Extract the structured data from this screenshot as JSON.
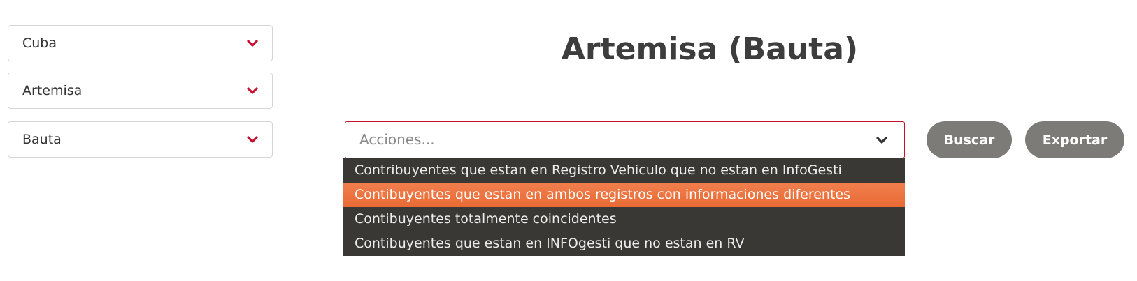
{
  "filters": {
    "country": {
      "selected": "Cuba"
    },
    "province": {
      "selected": "Artemisa"
    },
    "municipality": {
      "selected": "Bauta"
    }
  },
  "page_title": "Artemisa (Bauta)",
  "actions": {
    "placeholder": "Acciones...",
    "options": [
      "Contribuyentes que estan en Registro Vehiculo que no estan en InfoGesti",
      "Contibuyentes que estan en ambos registros con informaciones diferentes",
      "Contibuyentes totalmente coincidentes",
      "Contibuyentes que estan en INFOgesti que no estan en RV"
    ],
    "highlighted_index": 1
  },
  "buttons": {
    "search_label": "Buscar",
    "export_label": "Exportar"
  },
  "colors": {
    "accent_red": "#c8102e",
    "highlight_orange": "#ee7642",
    "dropdown_bg": "#3a3834",
    "button_gray": "#7d7b78",
    "title_text": "#3d3d3d"
  },
  "icons": {
    "select_caret": "chevron-down-icon"
  }
}
